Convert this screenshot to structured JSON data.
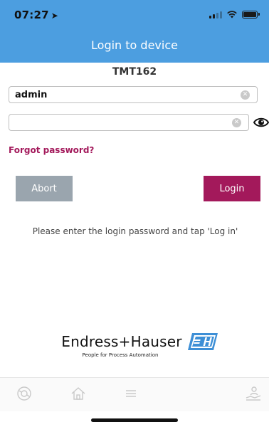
{
  "status_bar": {
    "time": "07:27",
    "location_glyph": "➤"
  },
  "nav": {
    "title": "Login to device"
  },
  "device": {
    "name": "TMT162"
  },
  "form": {
    "username_value": "admin",
    "username_placeholder": "",
    "password_value": "",
    "password_placeholder": "",
    "clear_glyph": "✕"
  },
  "links": {
    "forgot_password": "Forgot password?"
  },
  "buttons": {
    "abort": "Abort",
    "login": "Login"
  },
  "hint": {
    "text": "Please enter the login password and tap 'Log in'"
  },
  "brand": {
    "name": "Endress+Hauser",
    "tagline": "People for Process Automation"
  },
  "tabs": [
    {
      "icon": "settings-circle-icon"
    },
    {
      "icon": "home-icon"
    },
    {
      "icon": "menu-icon"
    },
    {
      "icon": "user-hand-icon"
    }
  ],
  "colors": {
    "header": "#4c9ee0",
    "accent": "#a3195b",
    "abort": "#9aa5ae",
    "logo": "#3d8fd6"
  }
}
